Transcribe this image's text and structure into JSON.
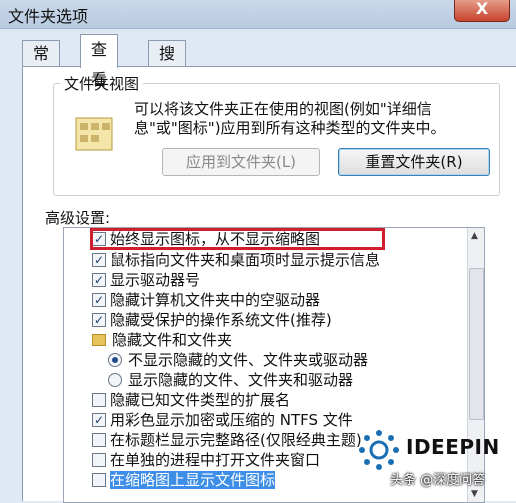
{
  "window": {
    "title": "文件夹选项",
    "close_glyph": "X"
  },
  "tabs": [
    {
      "label": "常规",
      "active": false
    },
    {
      "label": "查看",
      "active": true
    },
    {
      "label": "搜索",
      "active": false
    }
  ],
  "folder_views": {
    "legend": "文件夹视图",
    "description": "可以将该文件夹正在使用的视图(例如\"详细信息\"或\"图标\")应用到所有这种类型的文件夹中。",
    "apply_button": "应用到文件夹(L)",
    "reset_button": "重置文件夹(R)"
  },
  "advanced": {
    "label": "高级设置:",
    "items": [
      {
        "type": "checkbox",
        "checked": true,
        "label": "始终显示图标，从不显示缩略图",
        "highlighted": true
      },
      {
        "type": "checkbox",
        "checked": true,
        "label": "鼠标指向文件夹和桌面项时显示提示信息"
      },
      {
        "type": "checkbox",
        "checked": true,
        "label": "显示驱动器号"
      },
      {
        "type": "checkbox",
        "checked": true,
        "label": "隐藏计算机文件夹中的空驱动器"
      },
      {
        "type": "checkbox",
        "checked": true,
        "label": "隐藏受保护的操作系统文件(推荐)"
      },
      {
        "type": "folder",
        "label": "隐藏文件和文件夹"
      },
      {
        "type": "radio",
        "checked": true,
        "label": "不显示隐藏的文件、文件夹或驱动器"
      },
      {
        "type": "radio",
        "checked": false,
        "label": "显示隐藏的文件、文件夹和驱动器"
      },
      {
        "type": "checkbox",
        "checked": false,
        "label": "隐藏已知文件类型的扩展名"
      },
      {
        "type": "checkbox",
        "checked": true,
        "label": "用彩色显示加密或压缩的 NTFS 文件"
      },
      {
        "type": "checkbox",
        "checked": false,
        "label": "在标题栏显示完整路径(仅限经典主题)"
      },
      {
        "type": "checkbox",
        "checked": false,
        "label": "在单独的进程中打开文件夹窗口"
      },
      {
        "type": "checkbox",
        "checked": false,
        "label": "在缩略图上显示文件图标",
        "selected": true
      }
    ]
  },
  "watermark": {
    "brand": "IDEEPIN",
    "caption": "头条 @深度问答"
  },
  "colors": {
    "highlight_border": "#cf1f2e",
    "selection": "#3d8ee6"
  }
}
